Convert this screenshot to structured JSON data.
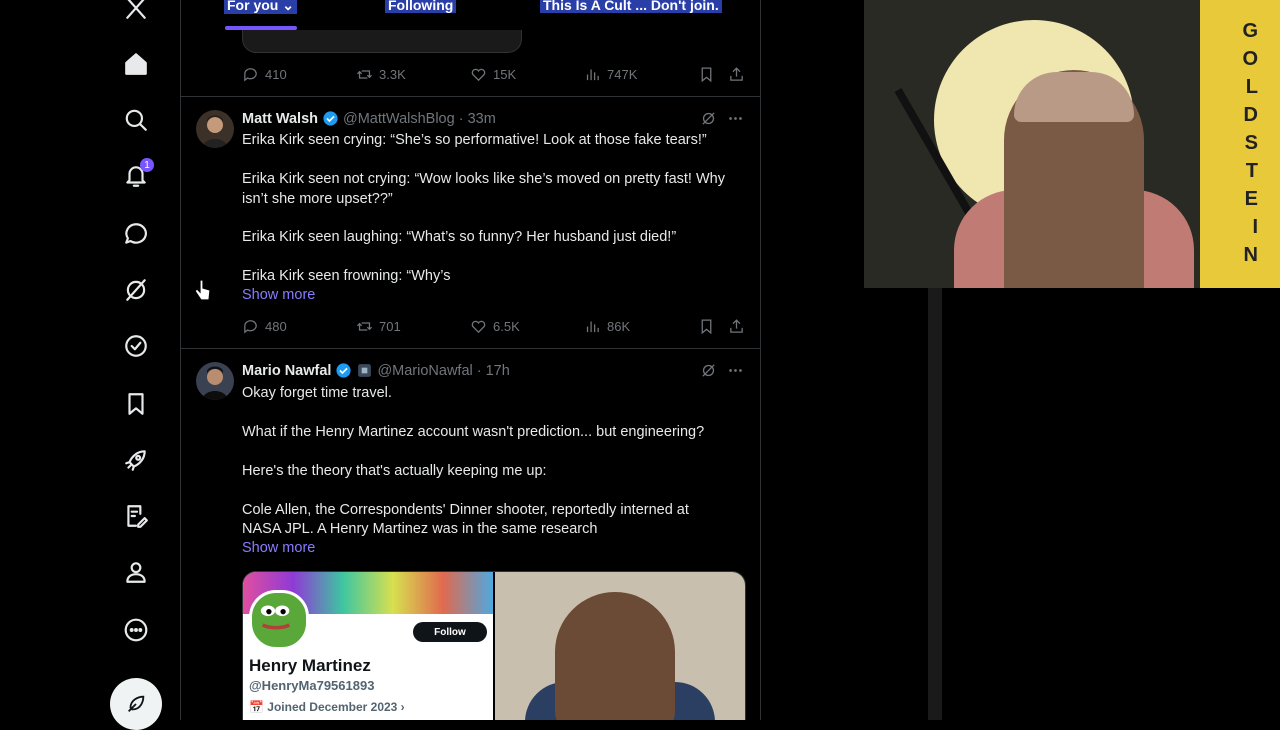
{
  "tabs": {
    "for_you": "For you",
    "following": "Following",
    "cult": "This Is A Cult ... Don't join."
  },
  "nav": {
    "notifications_badge": "1"
  },
  "top_tweet": {
    "replies": "410",
    "reposts": "3.3K",
    "likes": "15K",
    "views": "747K"
  },
  "tweets": [
    {
      "name": "Matt Walsh",
      "handle": "@MattWalshBlog · 33m",
      "lines": [
        "Erika Kirk seen crying: “She’s so performative! Look at those fake tears!”",
        "Erika Kirk seen not crying: “Wow looks like she’s moved on pretty fast! Why",
        "isn’t she more upset??”",
        "Erika Kirk seen laughing: “What’s so funny? Her husband just died!”",
        "Erika Kirk seen frowning: “Why’s"
      ],
      "show_more": "Show more",
      "replies": "480",
      "reposts": "701",
      "likes": "6.5K",
      "views": "86K"
    },
    {
      "name": "Mario Nawfal",
      "handle": "@MarioNawfal · 17h",
      "lines": [
        "Okay forget time travel.",
        "What if the Henry Martinez account wasn't prediction... but engineering?",
        "Here's the theory that's actually keeping me up:",
        "Cole Allen, the Correspondents' Dinner shooter, reportedly interned at",
        "NASA JPL. A Henry Martinez was in the same research"
      ],
      "show_more": "Show more",
      "media": {
        "follow": "Follow",
        "profile_name": "Henry Martinez",
        "profile_handle": "@HenryMa79561893",
        "joined": "Joined December 2023 ›"
      }
    }
  ],
  "webcam": {
    "banner_letters": [
      "G",
      "O",
      "L",
      "D",
      "S",
      "T",
      "E",
      "I",
      "N"
    ]
  },
  "colors": {
    "accent": "#7856ff",
    "link": "#8a7bff",
    "verified": "#1d9bf0",
    "muted": "#71767b"
  }
}
